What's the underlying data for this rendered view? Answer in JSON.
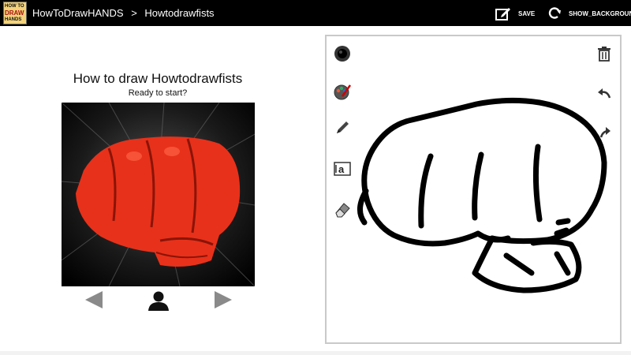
{
  "actionbar": {
    "logo_text": [
      "HOW TO",
      "DRAW",
      "HANDS"
    ],
    "breadcrumb": [
      "HowToDrawHANDS",
      ">",
      "Howtodrawfists"
    ],
    "save_label": "SAVE",
    "show_background_label": "SHOW_BACKGROUND"
  },
  "lesson": {
    "title": "How to draw Howtodrawfists",
    "subtitle": "Ready to start?"
  },
  "colors": {
    "actionbar_bg": "#000000",
    "fist_red": "#e8311a",
    "nav_gray": "#8a8a8a",
    "panel_border": "#c9c9c9"
  },
  "icons": {
    "save": "edit-icon",
    "show_background": "refresh-icon",
    "prev": "left-arrow-icon",
    "person": "person-icon",
    "next": "right-arrow-icon",
    "brush": "brush-size-icon",
    "color": "color-palette-icon",
    "pencil": "pencil-icon",
    "text": "text-tool-icon",
    "eraser": "eraser-icon",
    "delete": "trash-icon",
    "undo": "undo-icon",
    "redo": "redo-icon"
  }
}
